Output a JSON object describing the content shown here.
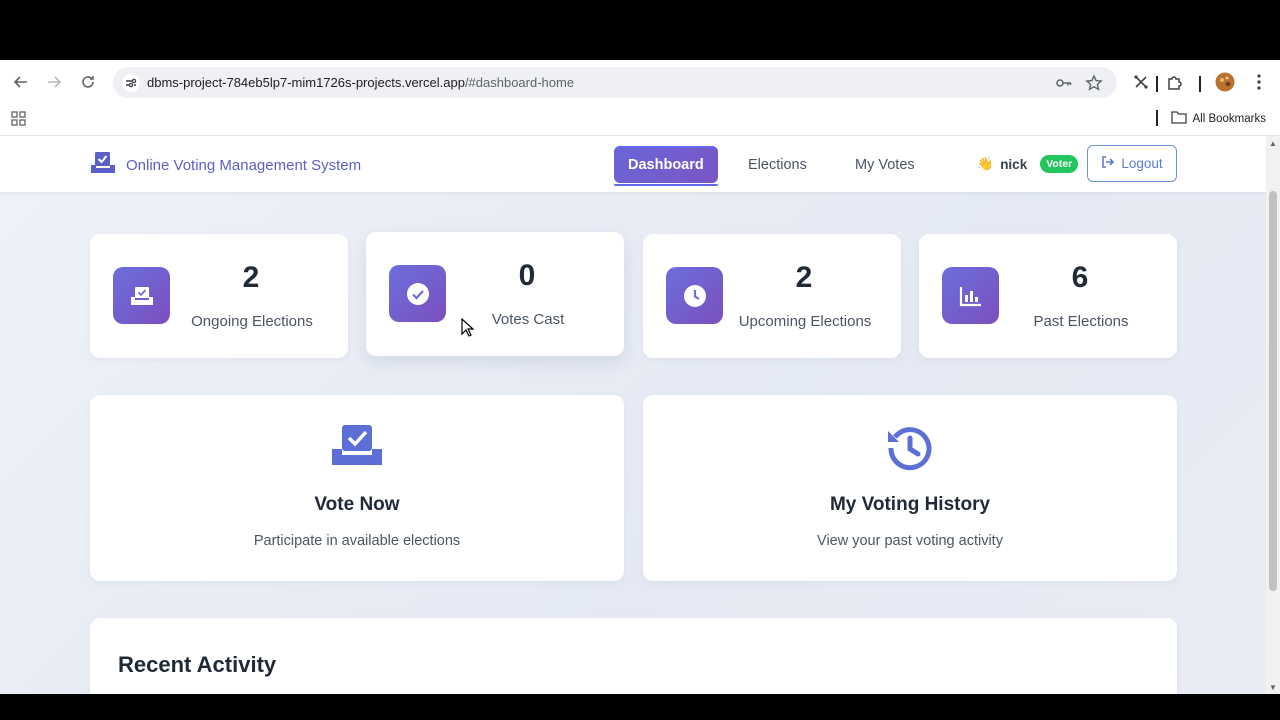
{
  "browser": {
    "url_host": "dbms-project-784eb5lp7-mim1726s-projects.vercel.app",
    "url_path": "/#dashboard-home",
    "bookmarks_label": "All Bookmarks"
  },
  "app": {
    "title": "Online Voting Management System",
    "nav": [
      {
        "label": "Dashboard",
        "active": true
      },
      {
        "label": "Elections",
        "active": false
      },
      {
        "label": "My Votes",
        "active": false
      }
    ],
    "user": {
      "emoji": "👋",
      "name": "nick",
      "role": "Voter"
    },
    "logout_label": "Logout"
  },
  "stats": [
    {
      "value": "2",
      "label": "Ongoing Elections",
      "icon": "ballot-box-icon"
    },
    {
      "value": "0",
      "label": "Votes Cast",
      "icon": "check-circle-icon"
    },
    {
      "value": "2",
      "label": "Upcoming Elections",
      "icon": "clock-icon"
    },
    {
      "value": "6",
      "label": "Past Elections",
      "icon": "bar-chart-icon"
    }
  ],
  "actions": [
    {
      "title": "Vote Now",
      "subtitle": "Participate in available elections",
      "icon": "vote-check-icon"
    },
    {
      "title": "My Voting History",
      "subtitle": "View your past voting activity",
      "icon": "history-icon"
    }
  ],
  "recent": {
    "title": "Recent Activity"
  },
  "colors": {
    "accent": "#6a66d8",
    "accent2": "#7b4fbe",
    "badge": "#22c55e",
    "brand_text": "#5b5fc7"
  }
}
